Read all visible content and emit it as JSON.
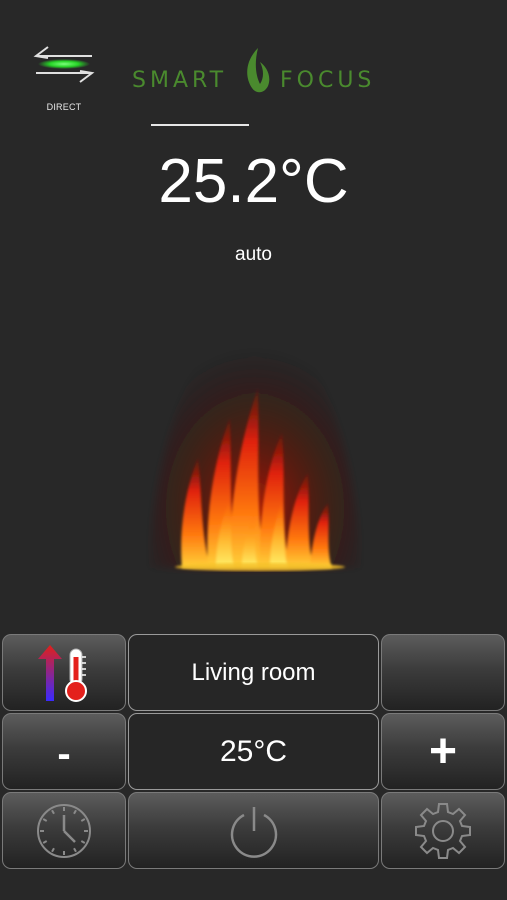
{
  "header": {
    "direct_label": "DIRECT",
    "logo_word_1": "SMART",
    "logo_word_2": "FOCUS"
  },
  "status": {
    "current_temperature": "25.2°C",
    "mode": "auto"
  },
  "controls": {
    "room_name": "Living room",
    "setpoint": "25°C",
    "decrease_label": "-",
    "increase_label": "+"
  },
  "colors": {
    "background": "#282828",
    "brand_green": "#4a8a2e",
    "direct_indicator": "#27d427",
    "flame_orange": "#ff6a00"
  },
  "icons": {
    "direct": "arrows-swap-icon",
    "heat_mode": "temperature-up-down-icon",
    "timer": "clock-icon",
    "power": "power-icon",
    "settings": "gear-icon"
  }
}
